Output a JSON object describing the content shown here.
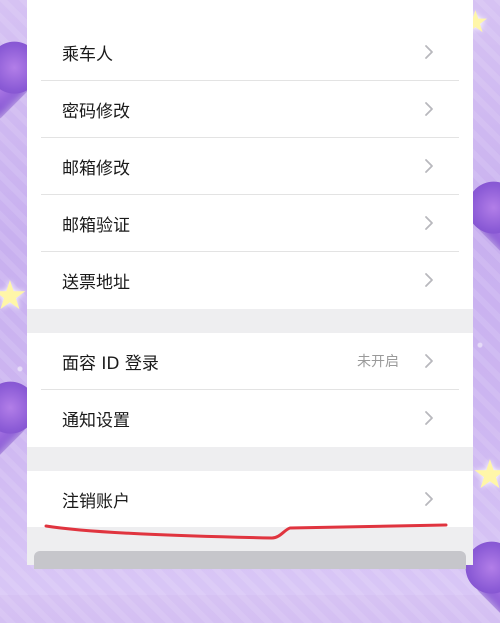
{
  "settings": {
    "group1": [
      {
        "label": "乘车人"
      },
      {
        "label": "密码修改"
      },
      {
        "label": "邮箱修改"
      },
      {
        "label": "邮箱验证"
      },
      {
        "label": "送票地址"
      }
    ],
    "group2": [
      {
        "label": "面容 ID 登录",
        "value": "未开启"
      },
      {
        "label": "通知设置"
      }
    ],
    "group3": [
      {
        "label": "注销账户"
      }
    ]
  },
  "icons": {
    "chevron": "chevron-right-icon"
  },
  "colors": {
    "annotation": "#e0343f",
    "chevron": "#b8b8bd",
    "separator_band": "#eeeef0"
  }
}
